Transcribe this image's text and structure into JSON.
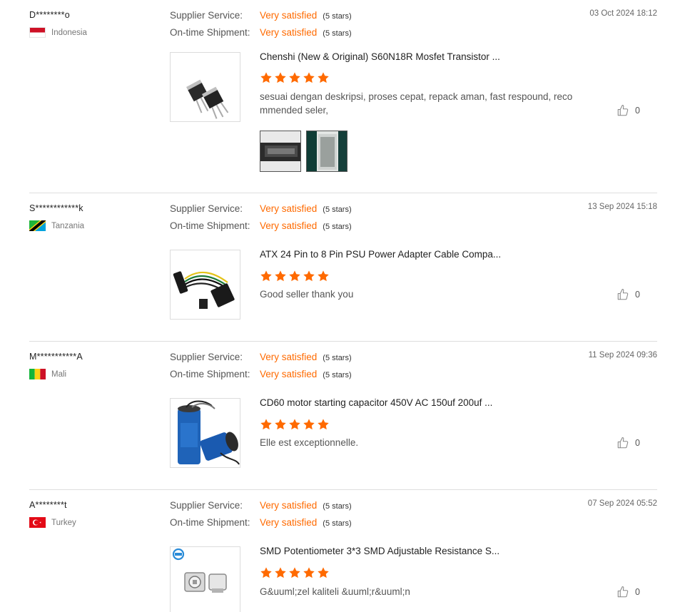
{
  "reviews": [
    {
      "buyer": "D********o",
      "country": "Indonesia",
      "supplier_service_label": "Supplier Service:",
      "supplier_service_value": "Very satisfied",
      "supplier_service_stars": "(5 stars)",
      "shipment_label": "On-time Shipment:",
      "shipment_value": "Very satisfied",
      "shipment_stars": "(5 stars)",
      "date": "03 Oct 2024 18:12",
      "product_title": "Chenshi (New & Original) S60N18R Mosfet Transistor ...",
      "rating": 5,
      "comment": "sesuai dengan deskripsi, proses cepat, repack aman, fast respound, recommended seler,",
      "likes": "0",
      "thumbnail_icon": "transistor-product-image",
      "photo_count": 2
    },
    {
      "buyer": "S************k",
      "country": "Tanzania",
      "supplier_service_label": "Supplier Service:",
      "supplier_service_value": "Very satisfied",
      "supplier_service_stars": "(5 stars)",
      "shipment_label": "On-time Shipment:",
      "shipment_value": "Very satisfied",
      "shipment_stars": "(5 stars)",
      "date": "13 Sep 2024 15:18",
      "product_title": "ATX 24 Pin to 8 Pin PSU Power Adapter Cable Compa...",
      "rating": 5,
      "comment": "Good seller thank you",
      "likes": "0",
      "thumbnail_icon": "cable-product-image"
    },
    {
      "buyer": "M***********A",
      "country": "Mali",
      "supplier_service_label": "Supplier Service:",
      "supplier_service_value": "Very satisfied",
      "supplier_service_stars": "(5 stars)",
      "shipment_label": "On-time Shipment:",
      "shipment_value": "Very satisfied",
      "shipment_stars": "(5 stars)",
      "date": "11 Sep 2024 09:36",
      "product_title": "CD60 motor starting capacitor 450V AC 150uf 200uf ...",
      "rating": 5,
      "comment": "Elle est exceptionnelle.",
      "likes": "0",
      "thumbnail_icon": "capacitor-product-image"
    },
    {
      "buyer": "A********t",
      "country": "Turkey",
      "supplier_service_label": "Supplier Service:",
      "supplier_service_value": "Very satisfied",
      "supplier_service_stars": "(5 stars)",
      "shipment_label": "On-time Shipment:",
      "shipment_value": "Very satisfied",
      "shipment_stars": "(5 stars)",
      "date": "07 Sep 2024 05:52",
      "product_title": "SMD Potentiometer 3*3 SMD Adjustable Resistance S...",
      "rating": 5,
      "comment": "G&uuml;zel kaliteli &uuml;r&uuml;n",
      "likes": "0",
      "thumbnail_icon": "potentiometer-product-image"
    }
  ],
  "colors": {
    "accent": "#ff6a00",
    "divider": "#dedede"
  }
}
